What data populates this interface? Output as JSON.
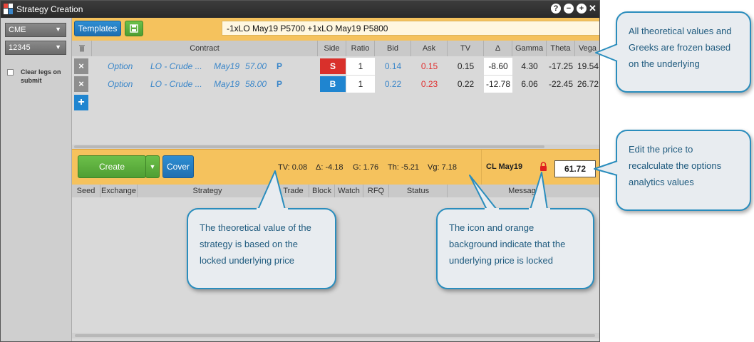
{
  "window": {
    "title": "Strategy Creation",
    "controls": [
      "?",
      "−",
      "+",
      "✕"
    ]
  },
  "sidebar": {
    "exchange_select": "CME",
    "account_select": "12345",
    "clear_legs_label": "Clear legs on submit"
  },
  "toolbar": {
    "templates_label": "Templates",
    "strategy_name": "-1xLO May19 P5700 +1xLO May19 P5800"
  },
  "legs_table": {
    "columns": [
      "Contract",
      "Side",
      "Ratio",
      "Bid",
      "Ask",
      "TV",
      "Δ",
      "Gamma",
      "Theta",
      "Vega"
    ],
    "rows": [
      {
        "type": "Option",
        "product": "LO - Crude ...",
        "expiry": "May19",
        "strike": "57.00",
        "put_call": "P",
        "side": "S",
        "ratio": "1",
        "bid": "0.14",
        "ask": "0.15",
        "tv": "0.15",
        "delta": "-8.60",
        "gamma": "4.30",
        "theta": "-17.25",
        "vega": "19.54"
      },
      {
        "type": "Option",
        "product": "LO - Crude ...",
        "expiry": "May19",
        "strike": "58.00",
        "put_call": "P",
        "side": "B",
        "ratio": "1",
        "bid": "0.22",
        "ask": "0.23",
        "tv": "0.22",
        "delta": "-12.78",
        "gamma": "6.06",
        "theta": "-22.45",
        "vega": "26.72"
      }
    ],
    "colors": {
      "sell": "#d9302b",
      "buy": "#1f85d0"
    }
  },
  "action_bar": {
    "create_label": "Create",
    "cover_label": "Cover",
    "tv": "TV: 0.08",
    "delta": "Δ: -4.18",
    "gamma": "G: 1.76",
    "theta": "Th: -5.21",
    "vega": "Vg: 7.18"
  },
  "underlying": {
    "label": "CL May19",
    "price": "61.72",
    "locked": true,
    "lock_icon": "lock-icon"
  },
  "orders_table": {
    "columns": [
      "Seed",
      "Exchange",
      "Strategy",
      "Trade",
      "Block",
      "Watch",
      "RFQ",
      "Status",
      "Message"
    ]
  },
  "callouts": {
    "greeks_frozen": "All theoretical values and Greeks are frozen based on the underlying",
    "edit_price": "Edit the price to recalculate the options analytics values",
    "tv_locked": "The theoretical value of the strategy is based on the locked underlying price",
    "lock_icon": "The icon and orange background indicate that the underlying price is locked"
  }
}
